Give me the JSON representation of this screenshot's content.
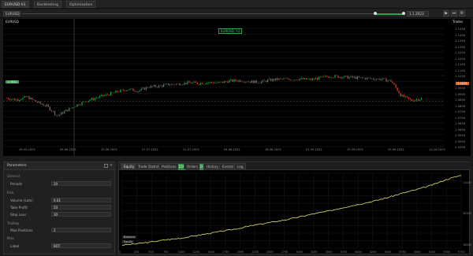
{
  "tabs": [
    {
      "label": "EURUSD h1"
    },
    {
      "label": "Backtesting"
    },
    {
      "label": "Optimization"
    }
  ],
  "toolbar": {
    "symbol_field": "EURUSD",
    "date_field": "1.1.2023"
  },
  "chart": {
    "symbol_label": "EURUSD",
    "top_badge": "EURUSD, h1",
    "right_badge": "Trades",
    "price_tag": "1.0835",
    "left_tag": "1.0832",
    "price_ticks": [
      "1.1450",
      "1.1400",
      "1.1350",
      "1.1300",
      "1.1250",
      "1.1200",
      "1.1150",
      "1.1100",
      "1.1050",
      "1.1000",
      "1.0950",
      "1.0900",
      "1.0850",
      "1.0800",
      "1.0750",
      "1.0700",
      "1.0650",
      "1.0600",
      "1.0550",
      "1.0500",
      "1.0450"
    ],
    "time_ticks": [
      "26.05.2023",
      "09.06.2023",
      "23.06.2023",
      "07.07.2023",
      "21.07.2023",
      "04.08.2023",
      "18.08.2023",
      "01.09.2023",
      "15.09.2023",
      "29.09.2023",
      "13.10.2023"
    ],
    "series_close": [
      1.086,
      1.0845,
      1.087,
      1.0825,
      1.079,
      1.071,
      1.076,
      1.0805,
      1.084,
      1.0865,
      1.089,
      1.0915,
      1.0935,
      1.092,
      1.0955,
      1.096,
      1.0975,
      1.098,
      1.099,
      1.0985,
      1.0992,
      1.0988,
      1.1005,
      1.101,
      1.1,
      1.0995,
      1.1012,
      1.102,
      1.1018,
      1.1022,
      1.1015,
      1.103,
      1.1045,
      1.104,
      1.1035,
      1.103,
      1.1025,
      1.102,
      1.1005,
      1.088,
      1.084,
      1.0855
    ]
  },
  "parameters": {
    "title": "Parameters",
    "section_general": "General",
    "label_period": "Periods",
    "value_period": "20",
    "section_risk": "Risk",
    "label_volume": "Volume (Lots)",
    "value_volume": "0.01",
    "label_tp": "Take Profit",
    "value_tp": "50",
    "label_sl": "Stop Loss",
    "value_sl": "30",
    "section_trading": "Trading",
    "label_max": "Max Positions",
    "value_max": "2",
    "section_misc": "Misc",
    "label_label": "Label",
    "value_label": "BOT"
  },
  "results": {
    "tabs": [
      {
        "label": "Equity"
      },
      {
        "label": "Trade Statistics"
      },
      {
        "label": "Positions",
        "badge": "150"
      },
      {
        "label": "Orders",
        "badge": "0"
      },
      {
        "label": "History"
      },
      {
        "label": "Events"
      },
      {
        "label": "Log"
      }
    ],
    "legend": [
      "Balance",
      "Equity"
    ],
    "x_ticks": [
      "0",
      "250",
      "500",
      "750",
      "1000",
      "1250",
      "1500",
      "1750",
      "2000",
      "2250",
      "2500",
      "2750",
      "3000",
      "3250",
      "3500",
      "3750",
      "4000",
      "4250",
      "4500",
      "4750",
      "5000",
      "5250",
      "5500",
      "5750"
    ],
    "y_ticks": [
      "11000",
      "10500",
      "10000"
    ],
    "equity": [
      10000,
      10020,
      10050,
      10085,
      10110,
      10150,
      10190,
      10230,
      10270,
      10320,
      10360,
      10400,
      10450,
      10500,
      10545,
      10600,
      10650,
      10700,
      10760,
      10830,
      10890,
      10960,
      11050,
      11120
    ]
  },
  "colors": {
    "accent_green": "#2fa24e",
    "equity_line": "#e3e36a",
    "bull": "#26a65b",
    "bear": "#d9453b"
  }
}
